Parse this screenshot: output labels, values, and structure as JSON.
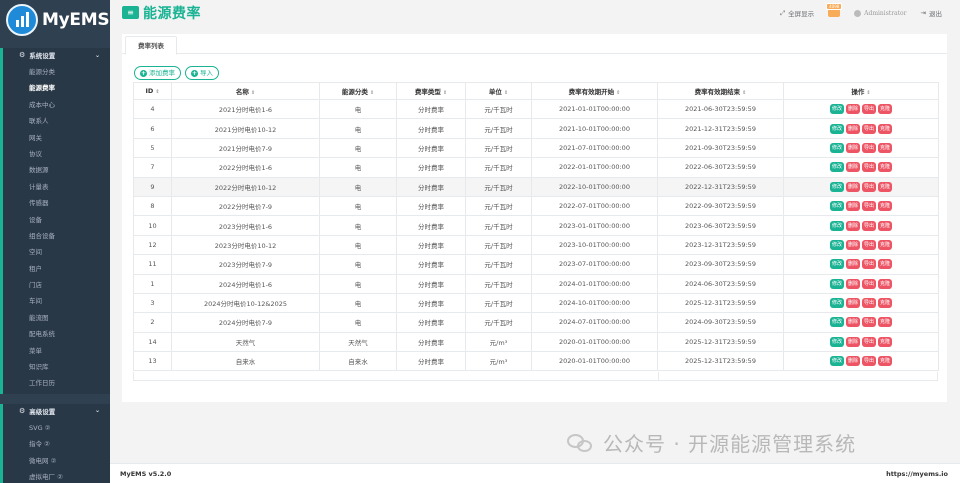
{
  "app": {
    "name": "MyEMS",
    "version": "MyEMS v5.2.0",
    "site": "https://myems.io"
  },
  "sidebar": {
    "group1": "系统设置",
    "items": [
      "能源分类",
      "能源费率",
      "成本中心",
      "联系人",
      "网关",
      "协议",
      "数据源",
      "计量表",
      "传感器",
      "设备",
      "组合设备",
      "空间",
      "租户",
      "门店",
      "车间",
      "能流图",
      "配电系统",
      "菜单",
      "知识库",
      "工作日历"
    ],
    "active_index": 1,
    "group2": "高级设置",
    "items2": [
      "SVG ②",
      "指令 ②",
      "微电网 ②",
      "虚拟电厂 ②"
    ]
  },
  "header": {
    "title": "能源费率",
    "fullscreen": "全屏显示",
    "notification_badge": "4098",
    "user": "Administrator",
    "logout": "退出"
  },
  "tab": "费率列表",
  "actions": {
    "add": "添加费率",
    "import": "导入"
  },
  "table": {
    "headers": [
      "ID",
      "名称",
      "能源分类",
      "费率类型",
      "单位",
      "费率有效期开始",
      "费率有效期结束",
      "操作"
    ],
    "ops": [
      "修改",
      "删除",
      "导出",
      "克隆"
    ],
    "rows": [
      [
        "4",
        "2021分时电价1-6",
        "电",
        "分时费率",
        "元/千瓦时",
        "2021-01-01T00:00:00",
        "2021-06-30T23:59:59"
      ],
      [
        "6",
        "2021分时电价10-12",
        "电",
        "分时费率",
        "元/千瓦时",
        "2021-10-01T00:00:00",
        "2021-12-31T23:59:59"
      ],
      [
        "5",
        "2021分时电价7-9",
        "电",
        "分时费率",
        "元/千瓦时",
        "2021-07-01T00:00:00",
        "2021-09-30T23:59:59"
      ],
      [
        "7",
        "2022分时电价1-6",
        "电",
        "分时费率",
        "元/千瓦时",
        "2022-01-01T00:00:00",
        "2022-06-30T23:59:59"
      ],
      [
        "9",
        "2022分时电价10-12",
        "电",
        "分时费率",
        "元/千瓦时",
        "2022-10-01T00:00:00",
        "2022-12-31T23:59:59"
      ],
      [
        "8",
        "2022分时电价7-9",
        "电",
        "分时费率",
        "元/千瓦时",
        "2022-07-01T00:00:00",
        "2022-09-30T23:59:59"
      ],
      [
        "10",
        "2023分时电价1-6",
        "电",
        "分时费率",
        "元/千瓦时",
        "2023-01-01T00:00:00",
        "2023-06-30T23:59:59"
      ],
      [
        "12",
        "2023分时电价10-12",
        "电",
        "分时费率",
        "元/千瓦时",
        "2023-10-01T00:00:00",
        "2023-12-31T23:59:59"
      ],
      [
        "11",
        "2023分时电价7-9",
        "电",
        "分时费率",
        "元/千瓦时",
        "2023-07-01T00:00:00",
        "2023-09-30T23:59:59"
      ],
      [
        "1",
        "2024分时电价1-6",
        "电",
        "分时费率",
        "元/千瓦时",
        "2024-01-01T00:00:00",
        "2024-06-30T23:59:59"
      ],
      [
        "3",
        "2024分时电价10-12&2025",
        "电",
        "分时费率",
        "元/千瓦时",
        "2024-10-01T00:00:00",
        "2025-12-31T23:59:59"
      ],
      [
        "2",
        "2024分时电价7-9",
        "电",
        "分时费率",
        "元/千瓦时",
        "2024-07-01T00:00:00",
        "2024-09-30T23:59:59"
      ],
      [
        "14",
        "天然气",
        "天然气",
        "分时费率",
        "元/m³",
        "2020-01-01T00:00:00",
        "2025-12-31T23:59:59"
      ],
      [
        "13",
        "自来水",
        "自来水",
        "分时费率",
        "元/m³",
        "2020-01-01T00:00:00",
        "2025-12-31T23:59:59"
      ]
    ],
    "highlight_index": 4
  },
  "watermark": "公众号 · 开源能源管理系统"
}
